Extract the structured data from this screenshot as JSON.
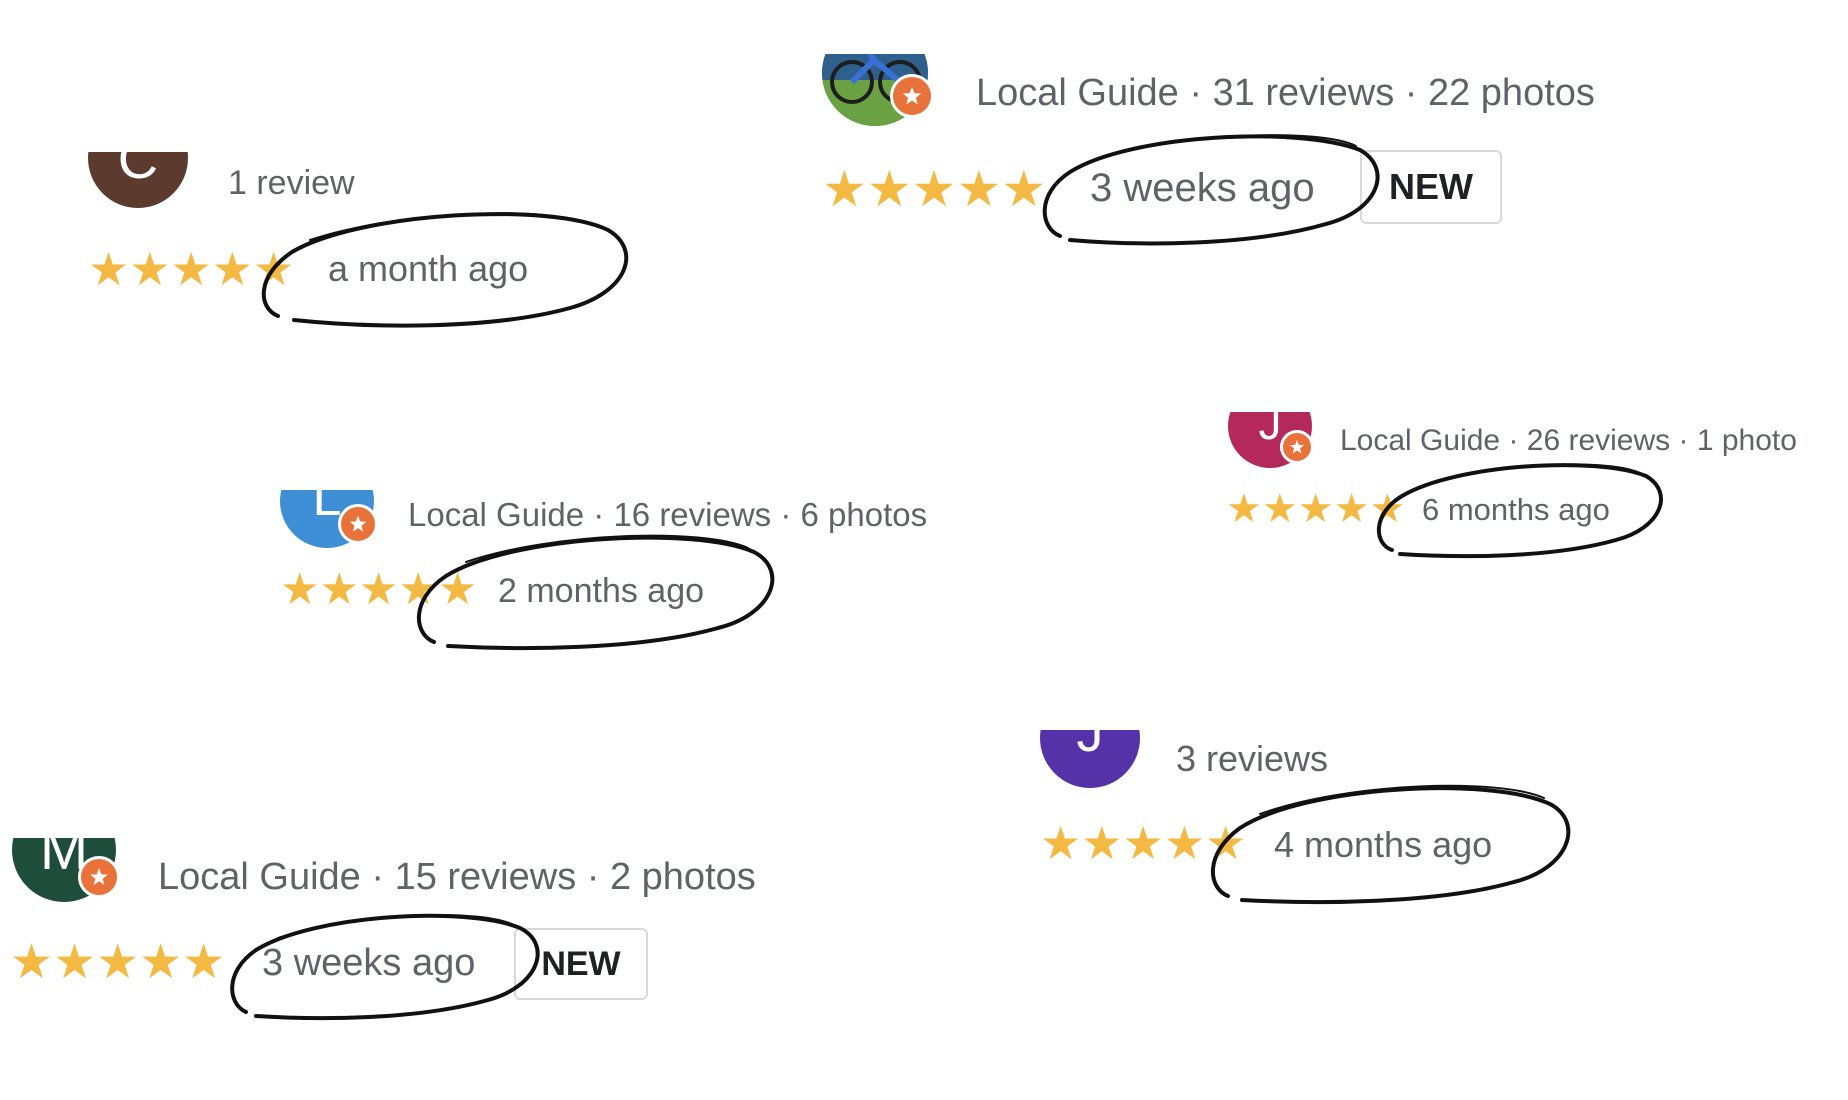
{
  "reviews": [
    {
      "id": "review-1",
      "avatar_letter": "C",
      "avatar_color": "#5c3b2e",
      "local_guide": false,
      "meta": "1 review",
      "stars": 5,
      "time": "a month ago",
      "new_badge": ""
    },
    {
      "id": "review-2",
      "avatar_letter": "",
      "avatar_color": "#5a8a3a",
      "local_guide": true,
      "meta": "Local Guide · 31 reviews · 22 photos",
      "stars": 5,
      "time": "3 weeks ago",
      "new_badge": "NEW"
    },
    {
      "id": "review-3",
      "avatar_letter": "J",
      "avatar_color": "#b5285a",
      "local_guide": true,
      "meta": "Local Guide · 26 reviews · 1 photo",
      "stars": 5,
      "time": "6 months ago",
      "new_badge": ""
    },
    {
      "id": "review-4",
      "avatar_letter": "L",
      "avatar_color": "#3f8fd6",
      "local_guide": true,
      "meta": "Local Guide · 16 reviews · 6 photos",
      "stars": 5,
      "time": "2 months ago",
      "new_badge": ""
    },
    {
      "id": "review-5",
      "avatar_letter": "J",
      "avatar_color": "#5632a8",
      "local_guide": false,
      "meta": "3 reviews",
      "stars": 5,
      "time": "4 months ago",
      "new_badge": ""
    },
    {
      "id": "review-6",
      "avatar_letter": "M",
      "avatar_color": "#1f4d3c",
      "local_guide": true,
      "meta": "Local Guide · 15 reviews · 2 photos",
      "stars": 5,
      "time": "3 weeks ago",
      "new_badge": "NEW"
    }
  ],
  "colors": {
    "star": "#f4b942",
    "meta_text": "#5f6368",
    "guide_badge": "#e8723a",
    "scribble": "#111111"
  },
  "icons": {
    "star": "star-icon",
    "guide_badge": "local-guide-badge-icon"
  }
}
